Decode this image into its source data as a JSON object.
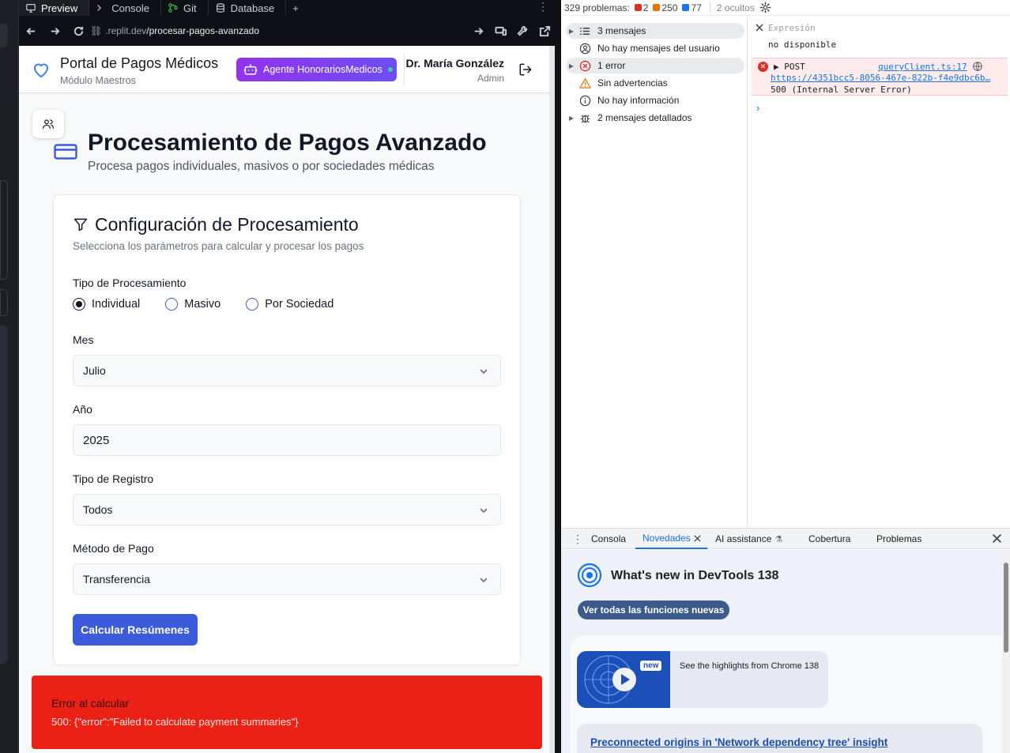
{
  "replit": {
    "tabs": [
      {
        "label": "Preview",
        "icon": "monitor-icon",
        "active": true
      },
      {
        "label": "Console",
        "icon": "terminal-icon",
        "active": false
      },
      {
        "label": "Git",
        "icon": "git-icon",
        "active": false
      },
      {
        "label": "Database",
        "icon": "database-icon",
        "active": false
      }
    ],
    "add_tab": "+",
    "kebab": "⋮",
    "url_host": ".replit.dev",
    "url_path": "/procesar-pagos-avanzado"
  },
  "header": {
    "title": "Portal de Pagos Médicos",
    "subtitle": "Módulo Maestros",
    "agent_label": "Agente HonorariosMedicos",
    "user_name": "Dr. María González",
    "user_role": "Admin"
  },
  "page": {
    "title": "Procesamiento de Pagos Avanzado",
    "subtitle": "Procesa pagos individuales, masivos o por sociedades médicas"
  },
  "config": {
    "title": "Configuración de Procesamiento",
    "subtitle": "Selecciona los parámetros para calcular y procesar los pagos",
    "type_label": "Tipo de Procesamiento",
    "type_options": [
      "Individual",
      "Masivo",
      "Por Sociedad"
    ],
    "type_selected": "Individual",
    "month_label": "Mes",
    "month_value": "Julio",
    "year_label": "Año",
    "year_value": "2025",
    "record_label": "Tipo de Registro",
    "record_value": "Todos",
    "method_label": "Método de Pago",
    "method_value": "Transferencia",
    "calc_button": "Calcular Resúmenes"
  },
  "error": {
    "title": "Error al calcular",
    "message": "500: {\"error\":\"Failed to calculate payment summaries\"}"
  },
  "devtools": {
    "problems": "329 problemas:",
    "errors_count": "2",
    "warnings_count": "250",
    "info_count": "77",
    "hidden": "2 ocultos",
    "sidebar": [
      {
        "label": "3 mensajes",
        "icon": "list-icon",
        "expandable": true
      },
      {
        "label": "No hay mensajes del usuario",
        "icon": "user-circle-icon",
        "expandable": false
      },
      {
        "label": "1 error",
        "icon": "error-icon",
        "expandable": true
      },
      {
        "label": "Sin advertencias",
        "icon": "warning-icon",
        "expandable": false
      },
      {
        "label": "No hay información",
        "icon": "info-icon",
        "expandable": false
      },
      {
        "label": "2 mensajes detallados",
        "icon": "bug-icon",
        "expandable": true
      }
    ],
    "expression_label": "Expresión",
    "expression_value": "no disponible",
    "error_method": "▶ POST",
    "error_source": "queryClient.ts:17",
    "error_url": "https://4351bcc5-8056-467e-822b-f4e9dbc6b…",
    "error_status": "500 (Internal Server Error)",
    "prompt": "›",
    "drawer_tabs": [
      "Consola",
      "Novedades",
      "AI assistance",
      "Cobertura",
      "Problemas"
    ],
    "drawer_active": "Novedades",
    "whatsnew_title": "What's new in DevTools 138",
    "whatsnew_button": "Ver todas las funciones nuevas",
    "video_badge": "new",
    "video_caption": "See the highlights from Chrome 138",
    "link_title": "Preconnected origins in 'Network dependency tree' insight"
  },
  "colors": {
    "primary": "#3b5bdb",
    "error_bg": "#ea2114",
    "agent_gradient_start": "#9333ea",
    "agent_gradient_end": "#6d4df5",
    "devtools_accent": "#1a73e8"
  }
}
